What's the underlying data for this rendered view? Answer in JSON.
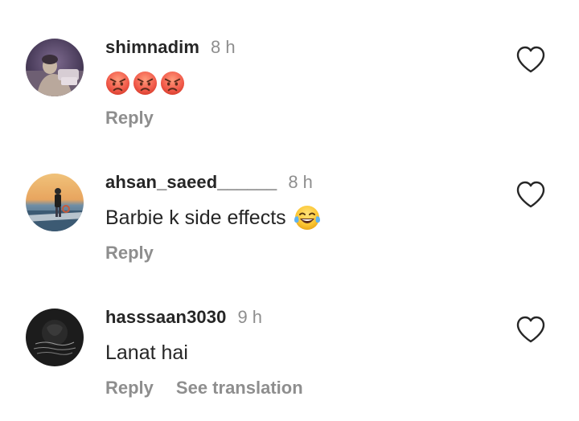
{
  "comments": [
    {
      "username": "shimnadim",
      "time": "8 h",
      "text": "",
      "emoji": [
        "angry-face",
        "angry-face",
        "angry-face"
      ],
      "actions": [
        "Reply"
      ],
      "avatar": "avatar-photo-dim-room"
    },
    {
      "username": "ahsan_saeed______",
      "time": "8 h",
      "text": "Barbie k side effects",
      "emoji": [
        "tears-of-joy-face"
      ],
      "actions": [
        "Reply"
      ],
      "avatar": "avatar-photo-sunset-sea"
    },
    {
      "username": "hasssaan3030",
      "time": "9 h",
      "text": "Lanat hai",
      "emoji": [],
      "actions": [
        "Reply",
        "See translation"
      ],
      "avatar": "avatar-dark-calligraphy"
    }
  ],
  "colors": {
    "text": "#262626",
    "secondary": "#8e8e8e",
    "background": "#ffffff"
  }
}
